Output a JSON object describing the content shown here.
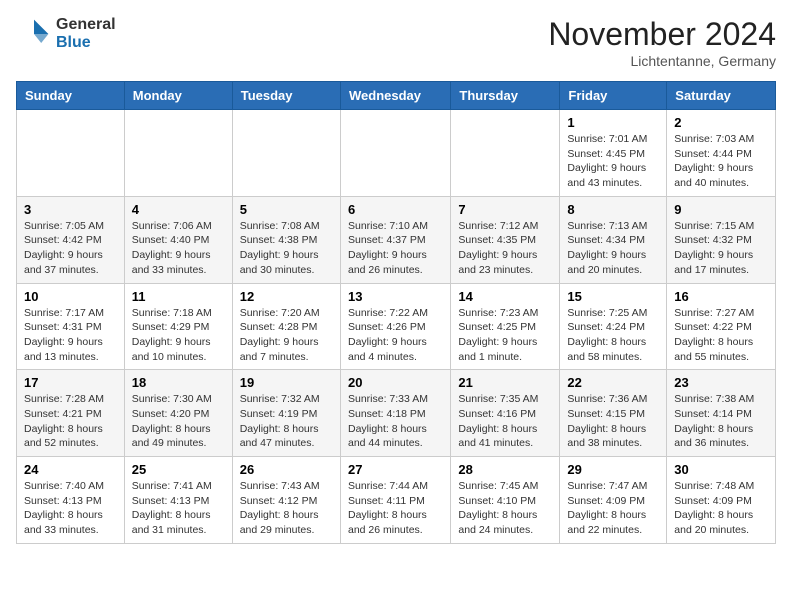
{
  "logo": {
    "general": "General",
    "blue": "Blue"
  },
  "header": {
    "month": "November 2024",
    "location": "Lichtentanne, Germany"
  },
  "weekdays": [
    "Sunday",
    "Monday",
    "Tuesday",
    "Wednesday",
    "Thursday",
    "Friday",
    "Saturday"
  ],
  "weeks": [
    [
      {
        "day": "",
        "info": ""
      },
      {
        "day": "",
        "info": ""
      },
      {
        "day": "",
        "info": ""
      },
      {
        "day": "",
        "info": ""
      },
      {
        "day": "",
        "info": ""
      },
      {
        "day": "1",
        "info": "Sunrise: 7:01 AM\nSunset: 4:45 PM\nDaylight: 9 hours and 43 minutes."
      },
      {
        "day": "2",
        "info": "Sunrise: 7:03 AM\nSunset: 4:44 PM\nDaylight: 9 hours and 40 minutes."
      }
    ],
    [
      {
        "day": "3",
        "info": "Sunrise: 7:05 AM\nSunset: 4:42 PM\nDaylight: 9 hours and 37 minutes."
      },
      {
        "day": "4",
        "info": "Sunrise: 7:06 AM\nSunset: 4:40 PM\nDaylight: 9 hours and 33 minutes."
      },
      {
        "day": "5",
        "info": "Sunrise: 7:08 AM\nSunset: 4:38 PM\nDaylight: 9 hours and 30 minutes."
      },
      {
        "day": "6",
        "info": "Sunrise: 7:10 AM\nSunset: 4:37 PM\nDaylight: 9 hours and 26 minutes."
      },
      {
        "day": "7",
        "info": "Sunrise: 7:12 AM\nSunset: 4:35 PM\nDaylight: 9 hours and 23 minutes."
      },
      {
        "day": "8",
        "info": "Sunrise: 7:13 AM\nSunset: 4:34 PM\nDaylight: 9 hours and 20 minutes."
      },
      {
        "day": "9",
        "info": "Sunrise: 7:15 AM\nSunset: 4:32 PM\nDaylight: 9 hours and 17 minutes."
      }
    ],
    [
      {
        "day": "10",
        "info": "Sunrise: 7:17 AM\nSunset: 4:31 PM\nDaylight: 9 hours and 13 minutes."
      },
      {
        "day": "11",
        "info": "Sunrise: 7:18 AM\nSunset: 4:29 PM\nDaylight: 9 hours and 10 minutes."
      },
      {
        "day": "12",
        "info": "Sunrise: 7:20 AM\nSunset: 4:28 PM\nDaylight: 9 hours and 7 minutes."
      },
      {
        "day": "13",
        "info": "Sunrise: 7:22 AM\nSunset: 4:26 PM\nDaylight: 9 hours and 4 minutes."
      },
      {
        "day": "14",
        "info": "Sunrise: 7:23 AM\nSunset: 4:25 PM\nDaylight: 9 hours and 1 minute."
      },
      {
        "day": "15",
        "info": "Sunrise: 7:25 AM\nSunset: 4:24 PM\nDaylight: 8 hours and 58 minutes."
      },
      {
        "day": "16",
        "info": "Sunrise: 7:27 AM\nSunset: 4:22 PM\nDaylight: 8 hours and 55 minutes."
      }
    ],
    [
      {
        "day": "17",
        "info": "Sunrise: 7:28 AM\nSunset: 4:21 PM\nDaylight: 8 hours and 52 minutes."
      },
      {
        "day": "18",
        "info": "Sunrise: 7:30 AM\nSunset: 4:20 PM\nDaylight: 8 hours and 49 minutes."
      },
      {
        "day": "19",
        "info": "Sunrise: 7:32 AM\nSunset: 4:19 PM\nDaylight: 8 hours and 47 minutes."
      },
      {
        "day": "20",
        "info": "Sunrise: 7:33 AM\nSunset: 4:18 PM\nDaylight: 8 hours and 44 minutes."
      },
      {
        "day": "21",
        "info": "Sunrise: 7:35 AM\nSunset: 4:16 PM\nDaylight: 8 hours and 41 minutes."
      },
      {
        "day": "22",
        "info": "Sunrise: 7:36 AM\nSunset: 4:15 PM\nDaylight: 8 hours and 38 minutes."
      },
      {
        "day": "23",
        "info": "Sunrise: 7:38 AM\nSunset: 4:14 PM\nDaylight: 8 hours and 36 minutes."
      }
    ],
    [
      {
        "day": "24",
        "info": "Sunrise: 7:40 AM\nSunset: 4:13 PM\nDaylight: 8 hours and 33 minutes."
      },
      {
        "day": "25",
        "info": "Sunrise: 7:41 AM\nSunset: 4:13 PM\nDaylight: 8 hours and 31 minutes."
      },
      {
        "day": "26",
        "info": "Sunrise: 7:43 AM\nSunset: 4:12 PM\nDaylight: 8 hours and 29 minutes."
      },
      {
        "day": "27",
        "info": "Sunrise: 7:44 AM\nSunset: 4:11 PM\nDaylight: 8 hours and 26 minutes."
      },
      {
        "day": "28",
        "info": "Sunrise: 7:45 AM\nSunset: 4:10 PM\nDaylight: 8 hours and 24 minutes."
      },
      {
        "day": "29",
        "info": "Sunrise: 7:47 AM\nSunset: 4:09 PM\nDaylight: 8 hours and 22 minutes."
      },
      {
        "day": "30",
        "info": "Sunrise: 7:48 AM\nSunset: 4:09 PM\nDaylight: 8 hours and 20 minutes."
      }
    ]
  ]
}
